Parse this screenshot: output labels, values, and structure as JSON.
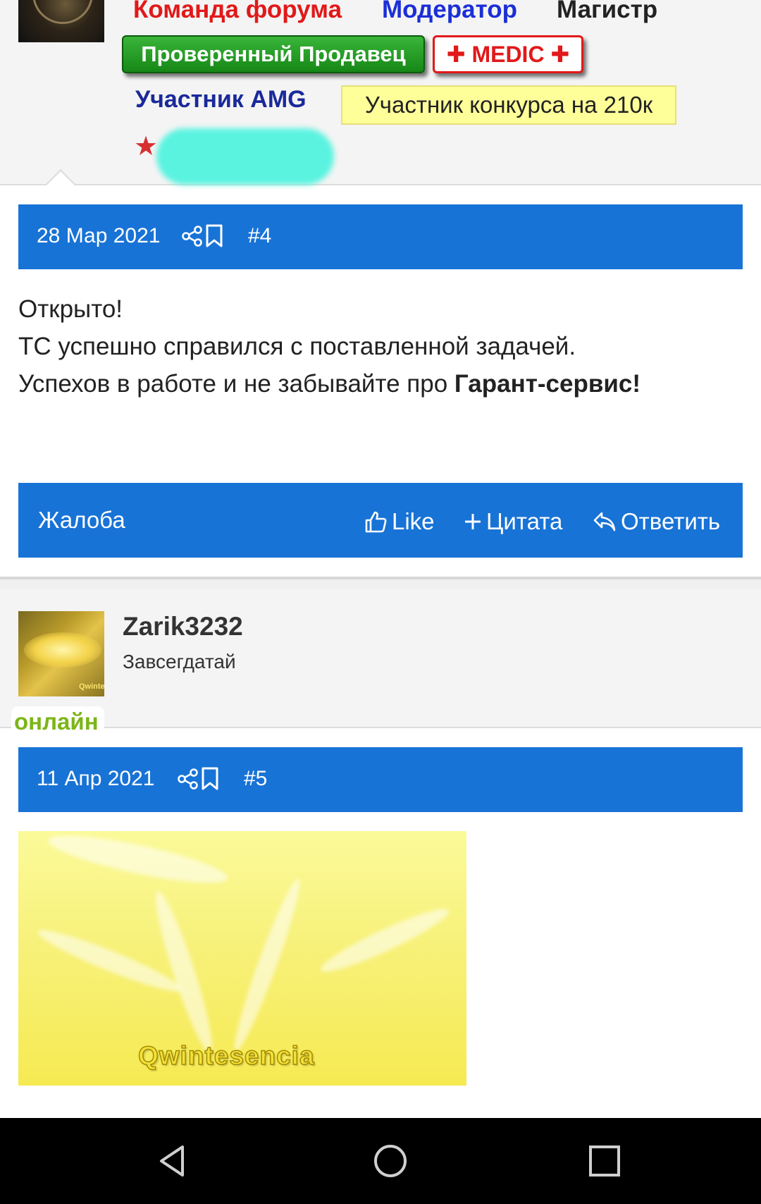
{
  "post4_author": {
    "roles": [
      "Команда форума",
      "Модератор",
      "Магистр"
    ],
    "badges": {
      "seller": "Проверенный Продавец",
      "medic": "✚ MEDIC ✚",
      "amg": "Участник AMG",
      "contest": "Участник конкурса на 210к"
    },
    "star_icon": "★"
  },
  "post4": {
    "date": "28 Мар 2021",
    "number": "#4",
    "lines": [
      "Открыто!",
      "ТС успешно справился с поставленной задачей.",
      "Успехов в работе и не забывайте про "
    ],
    "bold_text": "Гарант-сервис!",
    "footer": {
      "report": "Жалоба",
      "like": "Like",
      "quote": "Цитата",
      "reply": "Ответить"
    }
  },
  "post5_author": {
    "username": "Zarik3232",
    "title": "Завсегдатай",
    "online": "онлайн",
    "avatar_caption": "Qwintesencia"
  },
  "post5": {
    "date": "11 Апр 2021",
    "number": "#5",
    "image_watermark": "Qwintesencia"
  },
  "colors": {
    "bar_blue": "#1873d6",
    "role_team": "#e11919",
    "role_mod": "#1b2fd6",
    "online_green": "#7cb518",
    "contest_yellow": "#ffff99"
  },
  "icons": {
    "share": "share-icon",
    "bookmark": "bookmark-icon",
    "like": "thumbs-up-icon",
    "quote": "plus-icon",
    "reply": "reply-icon",
    "nav_back": "back-triangle-icon",
    "nav_home": "home-circle-icon",
    "nav_recents": "recents-square-icon"
  }
}
